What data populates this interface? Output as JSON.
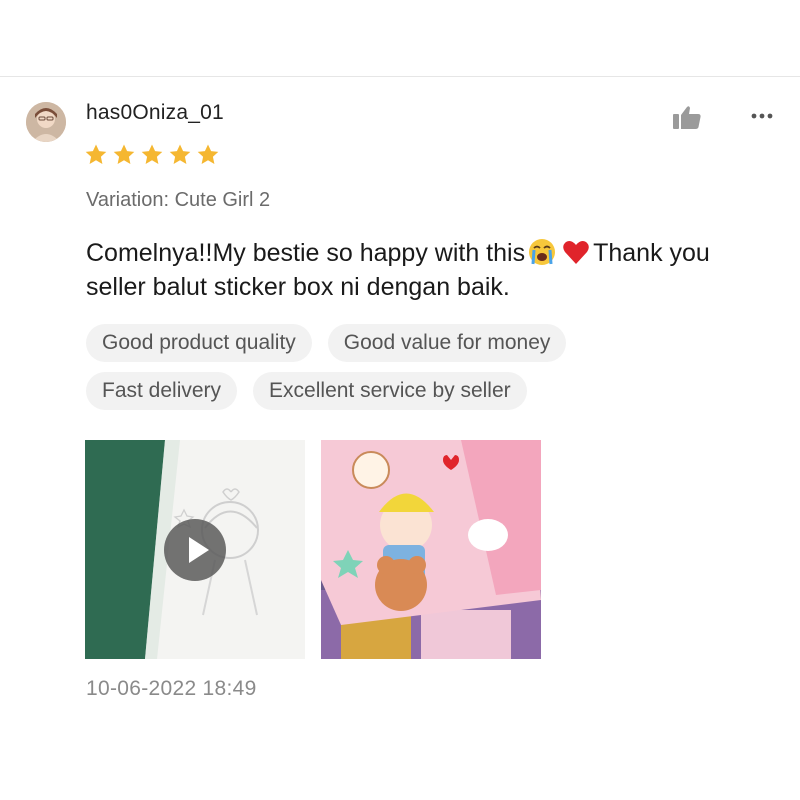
{
  "review": {
    "username": "has0Oniza_01",
    "rating": 5,
    "variation": "Variation: Cute Girl 2",
    "text_part1": "Comelnya!!My bestie so happy with this",
    "text_part2": "Thank you seller balut sticker box ni dengan baik.",
    "emojis": [
      "loudly-crying-face-emoji",
      "red-heart-emoji"
    ],
    "tags": [
      "Good product quality",
      "Good value for money",
      "Fast delivery",
      "Excellent service by seller"
    ],
    "media": [
      {
        "type": "video",
        "icon": "play-icon"
      },
      {
        "type": "photo"
      }
    ],
    "timestamp": "10-06-2022 18:49"
  },
  "actions": {
    "like_icon": "thumbs-up-icon",
    "more_icon": "more-dots-icon"
  },
  "colors": {
    "star": "#F5B731",
    "tag_bg": "#F2F2F2",
    "text_primary": "#1A1A1A",
    "text_secondary": "#6B6B6B",
    "icon_gray": "#9A9A9A"
  }
}
